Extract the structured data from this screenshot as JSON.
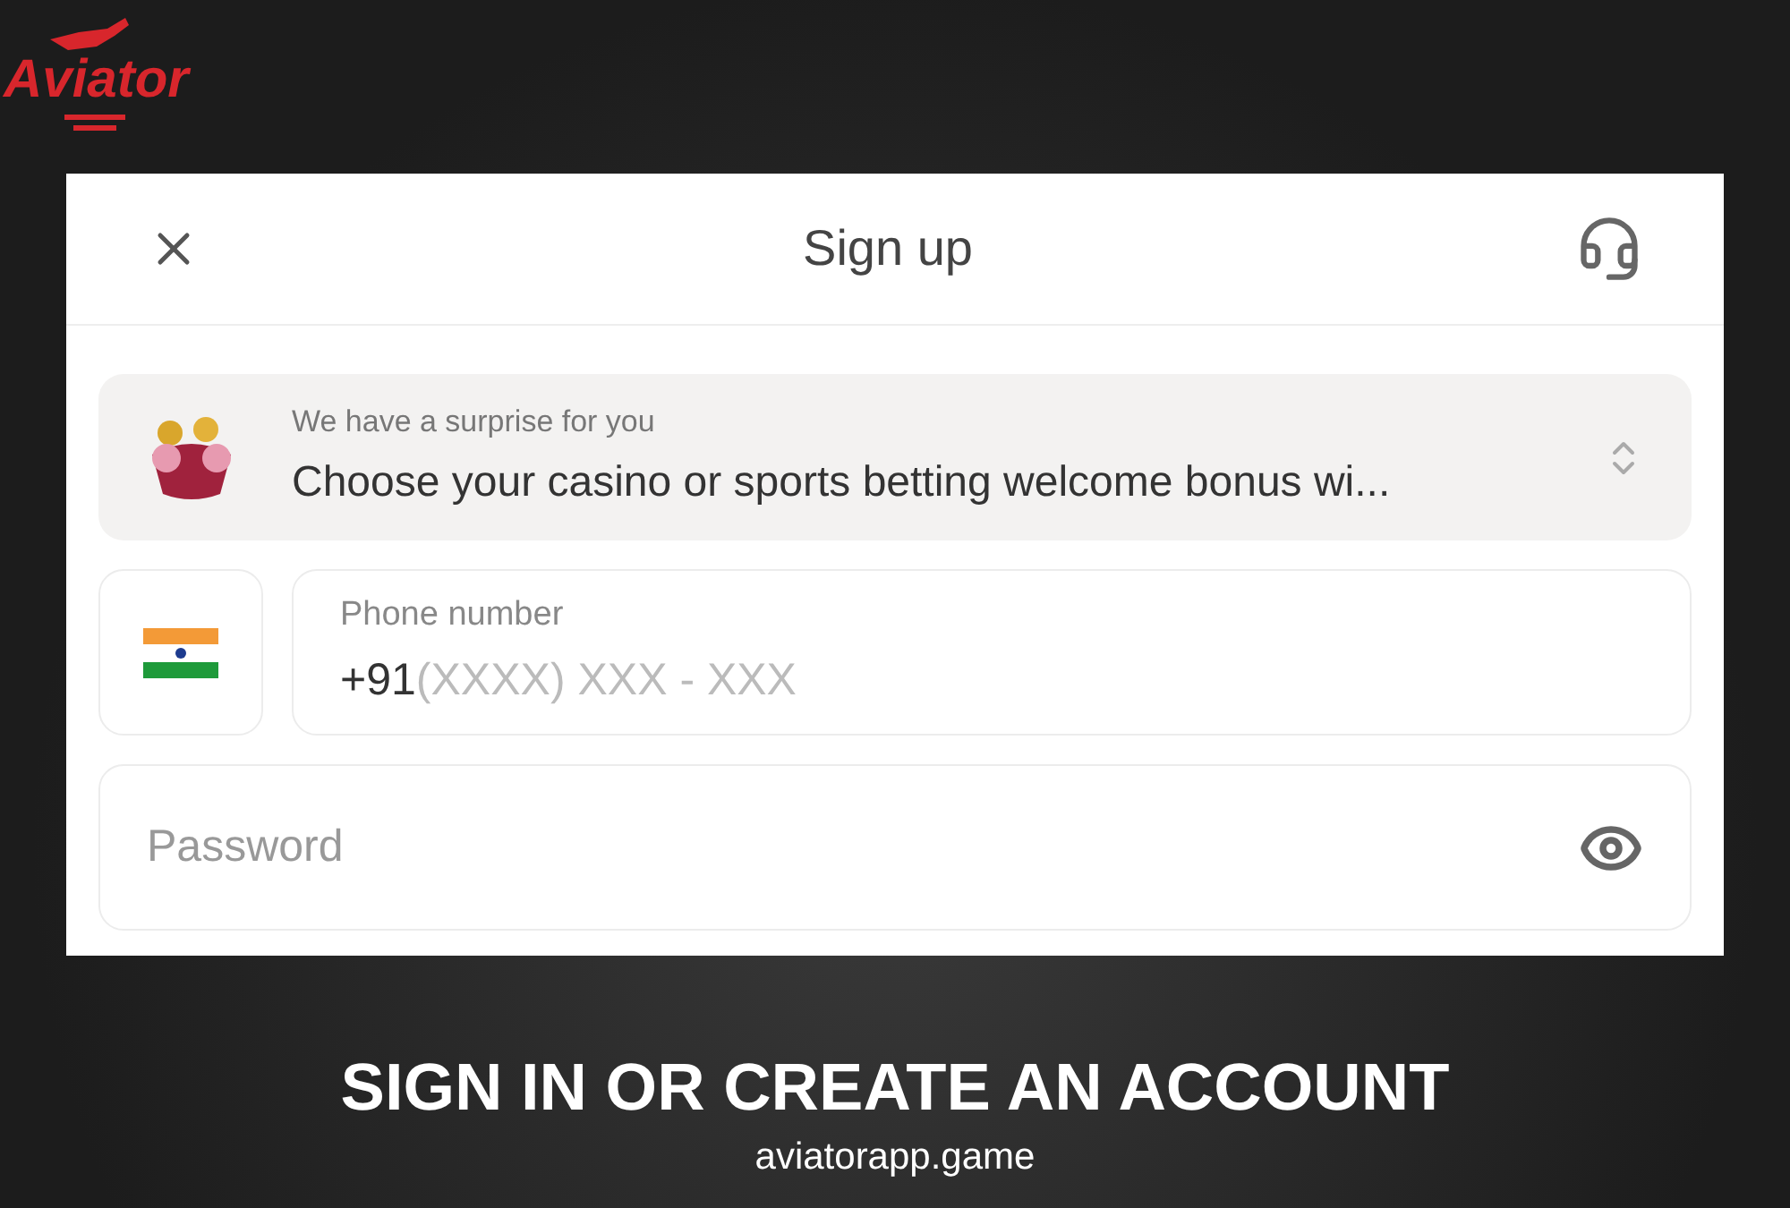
{
  "logo": {
    "text": "Aviator"
  },
  "dialog": {
    "title": "Sign up",
    "bonus": {
      "caption": "We have a surprise for you",
      "value": "Choose your casino or sports betting welcome bonus wi..."
    },
    "phone": {
      "label": "Phone number",
      "prefix": "+91",
      "placeholder": "(XXXX) XXX - XXX"
    },
    "password": {
      "placeholder": "Password"
    }
  },
  "headline": "SIGN IN OR CREATE AN ACCOUNT",
  "site": "aviatorapp.game"
}
